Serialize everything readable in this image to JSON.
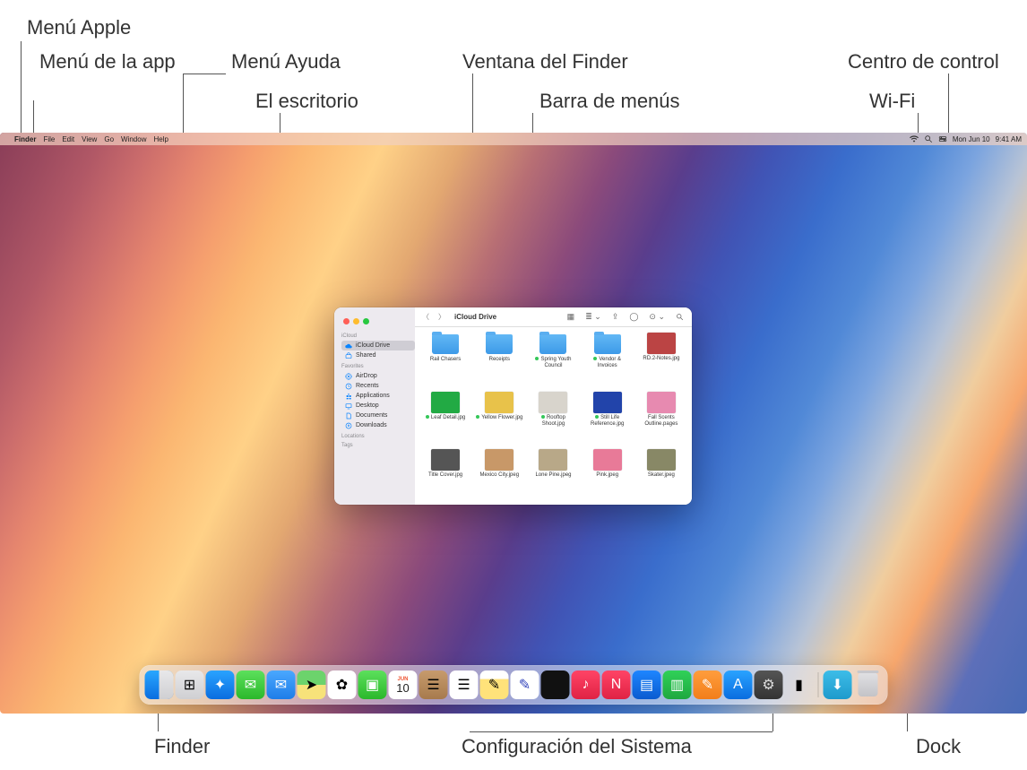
{
  "callouts": {
    "menu_apple": "Menú Apple",
    "menu_app": "Menú de la app",
    "menu_help": "Menú Ayuda",
    "desktop": "El escritorio",
    "finder_window": "Ventana del Finder",
    "menubar": "Barra de menús",
    "control_center": "Centro de control",
    "wifi": "Wi-Fi",
    "finder": "Finder",
    "system_settings": "Configuración del Sistema",
    "dock": "Dock"
  },
  "menubar": {
    "app_name": "Finder",
    "menus": [
      "File",
      "Edit",
      "View",
      "Go",
      "Window",
      "Help"
    ],
    "date": "Mon Jun 10",
    "time": "9:41 AM"
  },
  "finder": {
    "title": "iCloud Drive",
    "sidebar": {
      "sections": [
        {
          "label": "iCloud",
          "items": [
            {
              "name": "iCloud Drive",
              "icon": "cloud",
              "selected": true
            },
            {
              "name": "Shared",
              "icon": "shared",
              "selected": false
            }
          ]
        },
        {
          "label": "Favorites",
          "items": [
            {
              "name": "AirDrop",
              "icon": "airdrop"
            },
            {
              "name": "Recents",
              "icon": "clock"
            },
            {
              "name": "Applications",
              "icon": "apps"
            },
            {
              "name": "Desktop",
              "icon": "desktop"
            },
            {
              "name": "Documents",
              "icon": "doc"
            },
            {
              "name": "Downloads",
              "icon": "download"
            }
          ]
        },
        {
          "label": "Locations",
          "items": []
        },
        {
          "label": "Tags",
          "items": []
        }
      ]
    },
    "files": [
      {
        "name": "Rail Chasers",
        "type": "folder",
        "sync": false
      },
      {
        "name": "Receipts",
        "type": "folder",
        "sync": false
      },
      {
        "name": "Spring Youth Council",
        "type": "folder",
        "sync": true
      },
      {
        "name": "Vendor & Invoices",
        "type": "folder",
        "sync": true
      },
      {
        "name": "RD.2-Notes.jpg",
        "type": "image",
        "sync": false,
        "thumb_color": "#b44"
      },
      {
        "name": "Leaf Detail.jpg",
        "type": "image",
        "sync": true,
        "thumb_color": "#2a4"
      },
      {
        "name": "Yellow Flower.jpg",
        "type": "image",
        "sync": true,
        "thumb_color": "#e8c24a"
      },
      {
        "name": "Rooftop Shoot.jpg",
        "type": "image",
        "sync": true,
        "thumb_color": "#d8d4cc"
      },
      {
        "name": "Still Life Reference.jpg",
        "type": "image",
        "sync": true,
        "thumb_color": "#2244aa"
      },
      {
        "name": "Fall Scents Outline.pages",
        "type": "image",
        "sync": false,
        "thumb_color": "#e78ab0"
      },
      {
        "name": "Title Cover.jpg",
        "type": "image",
        "sync": false,
        "thumb_color": "#555"
      },
      {
        "name": "Mexico City.jpeg",
        "type": "image",
        "sync": false,
        "thumb_color": "#c89868"
      },
      {
        "name": "Lone Pine.jpeg",
        "type": "image",
        "sync": false,
        "thumb_color": "#b8a888"
      },
      {
        "name": "Pink.jpeg",
        "type": "image",
        "sync": false,
        "thumb_color": "#e87a98"
      },
      {
        "name": "Skater.jpeg",
        "type": "image",
        "sync": false,
        "thumb_color": "#886"
      }
    ]
  },
  "calendar_icon": {
    "month": "JUN",
    "day": "10"
  },
  "dock_apps": [
    "finder",
    "launchpad",
    "safari",
    "messages",
    "mail",
    "maps",
    "photos",
    "facetime",
    "calendar",
    "contacts",
    "reminders",
    "notes",
    "freeform",
    "tv",
    "music",
    "news",
    "keynote",
    "numbers",
    "pages",
    "appstore",
    "settings",
    "iphone-mirroring"
  ],
  "dock_right": [
    "downloads",
    "trash"
  ]
}
